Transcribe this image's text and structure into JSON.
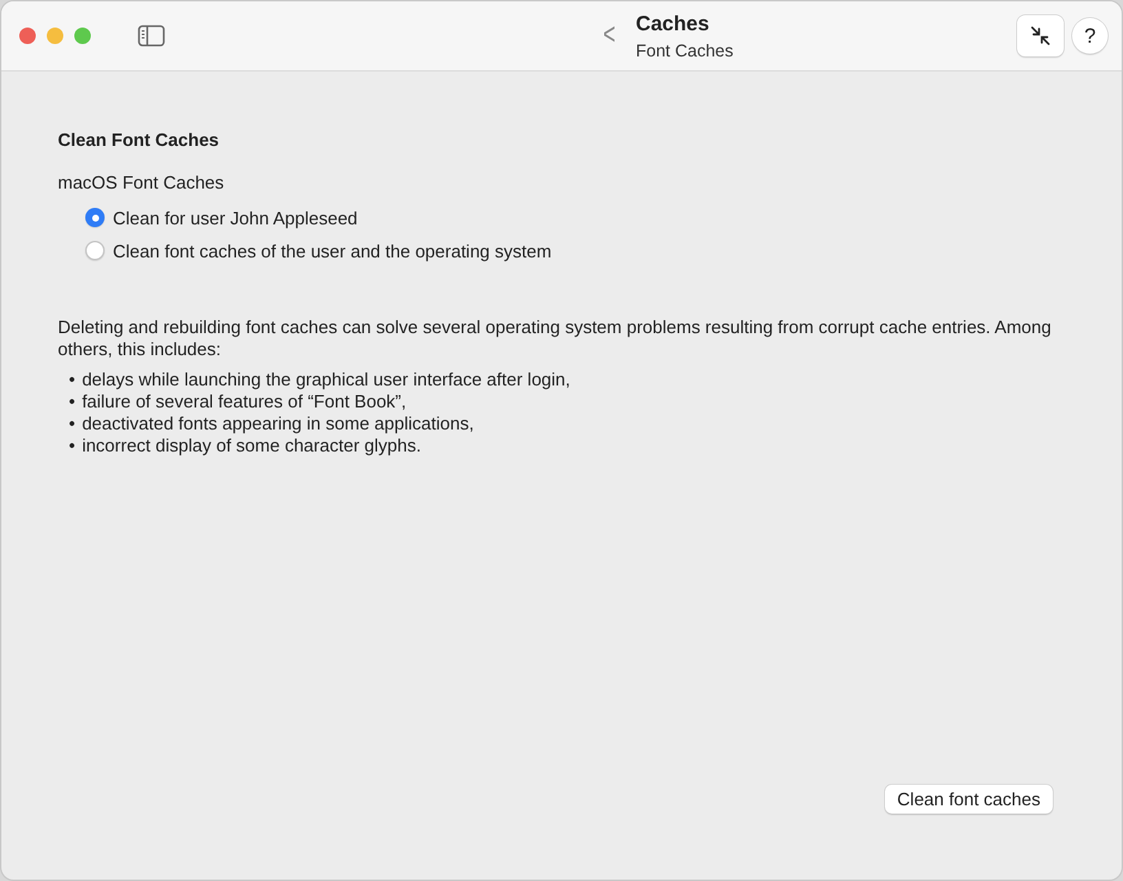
{
  "window": {
    "title": "Caches",
    "subtitle": "Font Caches",
    "back": "<",
    "help": "?"
  },
  "section": {
    "heading": "Clean Font Caches",
    "group_label": "macOS Font Caches",
    "options": [
      {
        "label": "Clean for user John Appleseed",
        "selected": true
      },
      {
        "label": "Clean font caches of the user and the operating system",
        "selected": false
      }
    ]
  },
  "description": "Deleting and rebuilding font caches can solve several operating system problems resulting from corrupt cache entries. Among others, this includes:",
  "bullet": "•",
  "items": [
    "delays while launching the graphical user interface after login,",
    "failure of several features of “Font Book”,",
    "deactivated fonts appearing in some applications,",
    "incorrect display of some character glyphs."
  ],
  "action": "Clean font caches"
}
